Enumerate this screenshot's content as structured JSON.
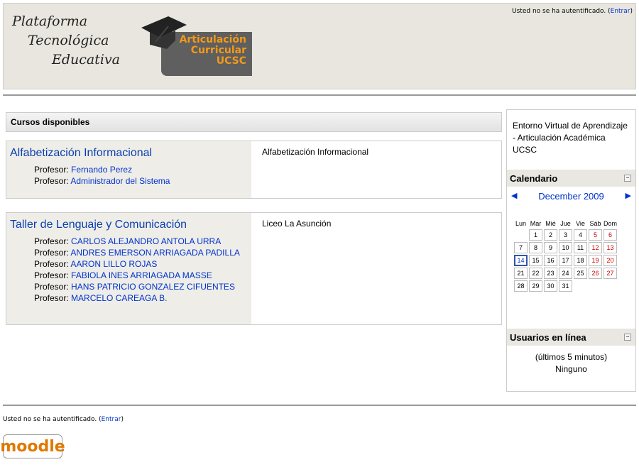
{
  "header": {
    "logo_lines": [
      "Plataforma",
      "Tecnológica",
      "Educativa"
    ],
    "badge_lines": [
      "Articulación",
      "Curricular",
      "UCSC"
    ],
    "login_text": "Usted no se ha autentificado. (",
    "login_link": "Entrar",
    "login_close": ")"
  },
  "courses": {
    "heading": "Cursos disponibles",
    "prof_label": "Profesor:",
    "items": [
      {
        "title": "Alfabetización Informacional",
        "summary": "Alfabetización Informacional",
        "teachers": [
          "Fernando Perez",
          "Administrador del Sistema"
        ]
      },
      {
        "title": "Taller de Lenguaje y Comunicación",
        "summary": "Liceo La Asunción",
        "teachers": [
          "CARLOS ALEJANDRO ANTOLA URRA",
          "ANDRES EMERSON ARRIAGADA PADILLA",
          "AARON LILLO ROJAS",
          "FABIOLA INES ARRIAGADA MASSE",
          "HANS PATRICIO GONZALEZ CIFUENTES",
          "MARCELO CAREAGA B."
        ]
      }
    ]
  },
  "sidebar": {
    "intro": "Entorno Virtual de Aprendizaje - Articulación Académica UCSC",
    "calendar": {
      "title": "Calendario",
      "month": "December 2009",
      "weekdays": [
        "Lun",
        "Mar",
        "Mié",
        "Jue",
        "Vie",
        "Sáb",
        "Dom"
      ],
      "weeks": [
        [
          "",
          "1",
          "2",
          "3",
          "4",
          "5",
          "6"
        ],
        [
          "7",
          "8",
          "9",
          "10",
          "11",
          "12",
          "13"
        ],
        [
          "14",
          "15",
          "16",
          "17",
          "18",
          "19",
          "20"
        ],
        [
          "21",
          "22",
          "23",
          "24",
          "25",
          "26",
          "27"
        ],
        [
          "28",
          "29",
          "30",
          "31",
          "",
          "",
          ""
        ]
      ],
      "today": "14"
    },
    "online": {
      "title": "Usuarios en línea",
      "period": "(últimos 5 minutos)",
      "value": "Ninguno"
    }
  },
  "footer": {
    "login_text": "Usted no se ha autentificado. (",
    "login_link": "Entrar",
    "login_close": ")",
    "logo": "moodle"
  },
  "colors": {
    "link": "#0033cc",
    "header_bg": "#e8e6df",
    "weekend": "#cc0000",
    "badge_text": "#f39a1a"
  }
}
